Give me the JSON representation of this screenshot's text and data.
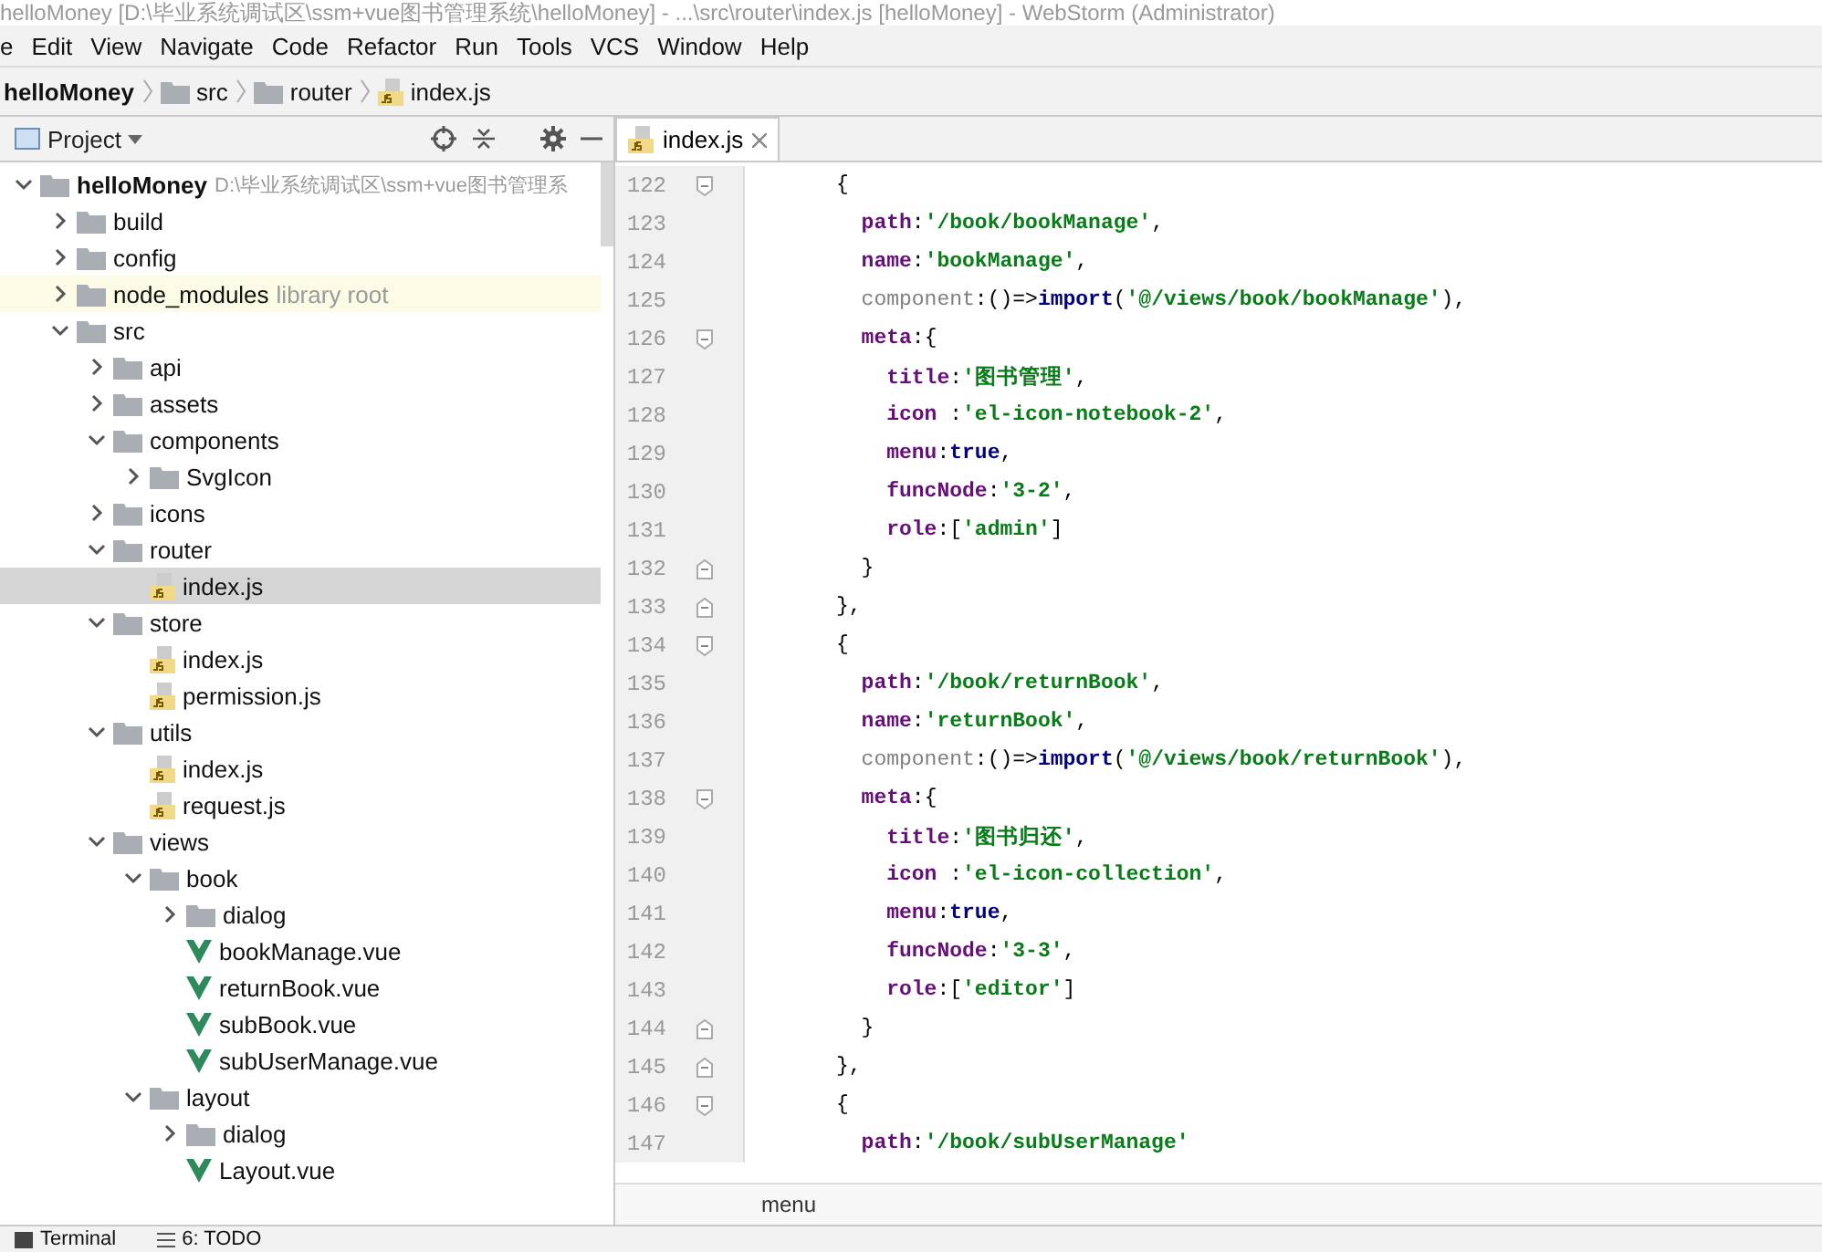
{
  "window": {
    "title": "helloMoney [D:\\毕业系统调试区\\ssm+vue图书管理系统\\helloMoney] - ...\\src\\router\\index.js [helloMoney] - WebStorm (Administrator)"
  },
  "menu_bar": [
    "e",
    "Edit",
    "View",
    "Navigate",
    "Code",
    "Refactor",
    "Run",
    "Tools",
    "VCS",
    "Window",
    "Help"
  ],
  "navigation_bar": [
    {
      "label": "helloMoney",
      "kind": "project"
    },
    {
      "label": "src",
      "kind": "folder"
    },
    {
      "label": "router",
      "kind": "folder"
    },
    {
      "label": "index.js",
      "kind": "js"
    }
  ],
  "project_panel": {
    "title": "Project",
    "tree": [
      {
        "label": "helloMoney",
        "kind": "root",
        "path": "D:\\毕业系统调试区\\ssm+vue图书管理系",
        "expanded": true,
        "selected": false,
        "children": [
          {
            "label": "build",
            "kind": "folder",
            "expanded": false,
            "selected": false
          },
          {
            "label": "config",
            "kind": "folder",
            "expanded": false,
            "selected": false
          },
          {
            "label": "node_modules",
            "kind": "folder",
            "note": "library root",
            "expanded": false,
            "selected": false
          },
          {
            "label": "src",
            "kind": "folder",
            "expanded": true,
            "selected": false,
            "children": [
              {
                "label": "api",
                "kind": "folder",
                "expanded": false,
                "selected": false
              },
              {
                "label": "assets",
                "kind": "folder",
                "expanded": false,
                "selected": false
              },
              {
                "label": "components",
                "kind": "folder",
                "expanded": true,
                "selected": false,
                "children": [
                  {
                    "label": "SvgIcon",
                    "kind": "folder",
                    "expanded": false,
                    "selected": false
                  }
                ]
              },
              {
                "label": "icons",
                "kind": "folder",
                "expanded": false,
                "selected": false
              },
              {
                "label": "router",
                "kind": "folder",
                "expanded": true,
                "selected": false,
                "children": [
                  {
                    "label": "index.js",
                    "kind": "js",
                    "selected": true
                  }
                ]
              },
              {
                "label": "store",
                "kind": "folder",
                "expanded": true,
                "selected": false,
                "children": [
                  {
                    "label": "index.js",
                    "kind": "js",
                    "selected": false
                  },
                  {
                    "label": "permission.js",
                    "kind": "js",
                    "selected": false
                  }
                ]
              },
              {
                "label": "utils",
                "kind": "folder",
                "expanded": true,
                "selected": false,
                "children": [
                  {
                    "label": "index.js",
                    "kind": "js",
                    "selected": false
                  },
                  {
                    "label": "request.js",
                    "kind": "js",
                    "selected": false
                  }
                ]
              },
              {
                "label": "views",
                "kind": "folder",
                "expanded": true,
                "selected": false,
                "children": [
                  {
                    "label": "book",
                    "kind": "folder",
                    "expanded": true,
                    "selected": false,
                    "children": [
                      {
                        "label": "dialog",
                        "kind": "folder",
                        "expanded": false,
                        "selected": false
                      },
                      {
                        "label": "bookManage.vue",
                        "kind": "vue",
                        "selected": false
                      },
                      {
                        "label": "returnBook.vue",
                        "kind": "vue",
                        "selected": false
                      },
                      {
                        "label": "subBook.vue",
                        "kind": "vue",
                        "selected": false
                      },
                      {
                        "label": "subUserManage.vue",
                        "kind": "vue",
                        "selected": false
                      }
                    ]
                  },
                  {
                    "label": "layout",
                    "kind": "folder",
                    "expanded": true,
                    "selected": false,
                    "children": [
                      {
                        "label": "dialog",
                        "kind": "folder",
                        "expanded": false,
                        "selected": false
                      },
                      {
                        "label": "Layout.vue",
                        "kind": "vue",
                        "selected": false
                      }
                    ]
                  }
                ]
              }
            ]
          }
        ]
      }
    ]
  },
  "editor": {
    "tabs": [
      {
        "label": "index.js",
        "selected": true
      }
    ],
    "lines": [
      {
        "number": "122",
        "fold_start": true,
        "tokens": [
          {
            "kind": "punct",
            "text": "{"
          }
        ]
      },
      {
        "number": "123",
        "tokens": [
          {
            "kind": "key",
            "text": "  path"
          },
          {
            "kind": "punct",
            "text": ":"
          },
          {
            "kind": "string",
            "text": "'/book/bookManage'"
          },
          {
            "kind": "punct",
            "text": ","
          }
        ]
      },
      {
        "number": "124",
        "tokens": [
          {
            "kind": "key",
            "text": "  name"
          },
          {
            "kind": "punct",
            "text": ":"
          },
          {
            "kind": "string",
            "text": "'bookManage'"
          },
          {
            "kind": "punct",
            "text": ","
          }
        ]
      },
      {
        "number": "125",
        "tokens": [
          {
            "kind": "unused",
            "text": "  component"
          },
          {
            "kind": "punct",
            "text": ":()=>"
          },
          {
            "kind": "keyword",
            "text": "import"
          },
          {
            "kind": "punct",
            "text": "("
          },
          {
            "kind": "string",
            "text": "'@/views/book/bookManage'"
          },
          {
            "kind": "punct",
            "text": "),"
          }
        ]
      },
      {
        "number": "126",
        "fold_start": true,
        "tokens": [
          {
            "kind": "key",
            "text": "  meta"
          },
          {
            "kind": "punct",
            "text": ":{"
          }
        ]
      },
      {
        "number": "127",
        "tokens": [
          {
            "kind": "key",
            "text": "    title"
          },
          {
            "kind": "punct",
            "text": ":"
          },
          {
            "kind": "string",
            "text": "'图书管理'"
          },
          {
            "kind": "punct",
            "text": ","
          }
        ]
      },
      {
        "number": "128",
        "tokens": [
          {
            "kind": "key",
            "text": "    icon "
          },
          {
            "kind": "punct",
            "text": ":"
          },
          {
            "kind": "string",
            "text": "'el-icon-notebook-2'"
          },
          {
            "kind": "punct",
            "text": ","
          }
        ]
      },
      {
        "number": "129",
        "tokens": [
          {
            "kind": "key",
            "text": "    menu"
          },
          {
            "kind": "punct",
            "text": ":"
          },
          {
            "kind": "keyword",
            "text": "true"
          },
          {
            "kind": "punct",
            "text": ","
          }
        ]
      },
      {
        "number": "130",
        "tokens": [
          {
            "kind": "key",
            "text": "    funcNode"
          },
          {
            "kind": "punct",
            "text": ":"
          },
          {
            "kind": "string",
            "text": "'3-2'"
          },
          {
            "kind": "punct",
            "text": ","
          }
        ]
      },
      {
        "number": "131",
        "tokens": [
          {
            "kind": "key",
            "text": "    role"
          },
          {
            "kind": "punct",
            "text": ":["
          },
          {
            "kind": "string",
            "text": "'admin'"
          },
          {
            "kind": "punct",
            "text": "]"
          }
        ]
      },
      {
        "number": "132",
        "fold_end": true,
        "tokens": [
          {
            "kind": "punct",
            "text": "  }"
          }
        ]
      },
      {
        "number": "133",
        "fold_end": true,
        "tokens": [
          {
            "kind": "punct",
            "text": "},"
          }
        ]
      },
      {
        "number": "134",
        "fold_start": true,
        "tokens": [
          {
            "kind": "punct",
            "text": "{"
          }
        ]
      },
      {
        "number": "135",
        "tokens": [
          {
            "kind": "key",
            "text": "  path"
          },
          {
            "kind": "punct",
            "text": ":"
          },
          {
            "kind": "string",
            "text": "'/book/returnBook'"
          },
          {
            "kind": "punct",
            "text": ","
          }
        ]
      },
      {
        "number": "136",
        "tokens": [
          {
            "kind": "key",
            "text": "  name"
          },
          {
            "kind": "punct",
            "text": ":"
          },
          {
            "kind": "string",
            "text": "'returnBook'"
          },
          {
            "kind": "punct",
            "text": ","
          }
        ]
      },
      {
        "number": "137",
        "tokens": [
          {
            "kind": "unused",
            "text": "  component"
          },
          {
            "kind": "punct",
            "text": ":()=>"
          },
          {
            "kind": "keyword",
            "text": "import"
          },
          {
            "kind": "punct",
            "text": "("
          },
          {
            "kind": "string",
            "text": "'@/views/book/returnBook'"
          },
          {
            "kind": "punct",
            "text": "),"
          }
        ]
      },
      {
        "number": "138",
        "fold_start": true,
        "tokens": [
          {
            "kind": "key",
            "text": "  meta"
          },
          {
            "kind": "punct",
            "text": ":{"
          }
        ]
      },
      {
        "number": "139",
        "tokens": [
          {
            "kind": "key",
            "text": "    title"
          },
          {
            "kind": "punct",
            "text": ":"
          },
          {
            "kind": "string",
            "text": "'图书归还'"
          },
          {
            "kind": "punct",
            "text": ","
          }
        ]
      },
      {
        "number": "140",
        "tokens": [
          {
            "kind": "key",
            "text": "    icon "
          },
          {
            "kind": "punct",
            "text": ":"
          },
          {
            "kind": "string",
            "text": "'el-icon-collection'"
          },
          {
            "kind": "punct",
            "text": ","
          }
        ]
      },
      {
        "number": "141",
        "tokens": [
          {
            "kind": "key",
            "text": "    menu"
          },
          {
            "kind": "punct",
            "text": ":"
          },
          {
            "kind": "keyword",
            "text": "true"
          },
          {
            "kind": "punct",
            "text": ","
          }
        ]
      },
      {
        "number": "142",
        "tokens": [
          {
            "kind": "key",
            "text": "    funcNode"
          },
          {
            "kind": "punct",
            "text": ":"
          },
          {
            "kind": "string",
            "text": "'3-3'"
          },
          {
            "kind": "punct",
            "text": ","
          }
        ]
      },
      {
        "number": "143",
        "tokens": [
          {
            "kind": "key",
            "text": "    role"
          },
          {
            "kind": "punct",
            "text": ":["
          },
          {
            "kind": "string",
            "text": "'editor'"
          },
          {
            "kind": "punct",
            "text": "]"
          }
        ]
      },
      {
        "number": "144",
        "fold_end": true,
        "tokens": [
          {
            "kind": "punct",
            "text": "  }"
          }
        ]
      },
      {
        "number": "145",
        "fold_end": true,
        "tokens": [
          {
            "kind": "punct",
            "text": "},"
          }
        ]
      },
      {
        "number": "146",
        "fold_start": true,
        "tokens": [
          {
            "kind": "punct",
            "text": "{"
          }
        ]
      },
      {
        "number": "147",
        "tokens": [
          {
            "kind": "key",
            "text": "  path"
          },
          {
            "kind": "punct",
            "text": ":"
          },
          {
            "kind": "string",
            "text": "'/book/subUserManage'"
          }
        ]
      }
    ],
    "breadcrumb": "menu"
  },
  "bottom_bar": [
    {
      "label": "Terminal",
      "kind": "terminal"
    },
    {
      "label": "6: TODO",
      "kind": "todo"
    }
  ]
}
